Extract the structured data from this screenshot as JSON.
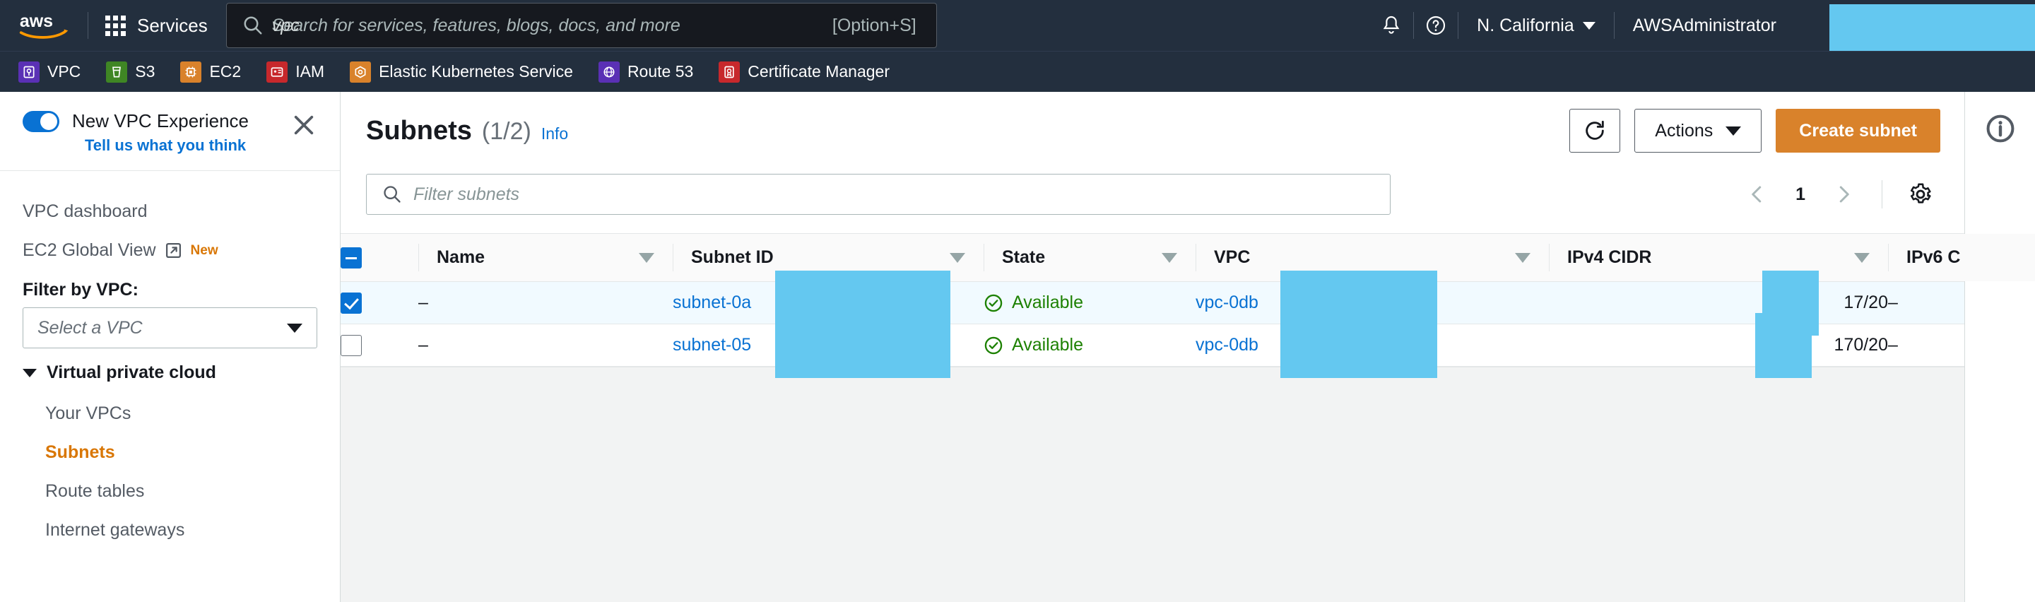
{
  "topnav": {
    "logo_alt": "aws",
    "services_label": "Services",
    "search": {
      "placeholder": "Search for services, features, blogs, docs, and more",
      "value": "vpc",
      "shortcut": "[Option+S]"
    },
    "bell_icon": "notifications-bell-icon",
    "help_icon": "help-circle-icon",
    "region": "N. California",
    "account": "AWSAdministrator",
    "redacted": true
  },
  "service_bar": {
    "items": [
      {
        "label": "VPC",
        "color": "#5a30b5",
        "icon": "vpc-icon"
      },
      {
        "label": "S3",
        "color": "#3f8624",
        "icon": "s3-bucket-icon"
      },
      {
        "label": "EC2",
        "color": "#d9822b",
        "icon": "ec2-instance-icon"
      },
      {
        "label": "IAM",
        "color": "#c7282c",
        "icon": "iam-icon"
      },
      {
        "label": "Elastic Kubernetes Service",
        "color": "#d9822b",
        "icon": "eks-icon"
      },
      {
        "label": "Route 53",
        "color": "#5a30b5",
        "icon": "route53-icon"
      },
      {
        "label": "Certificate Manager",
        "color": "#c7282c",
        "icon": "certificate-icon"
      }
    ]
  },
  "sidebar": {
    "new_experience": {
      "title": "New VPC Experience",
      "feedback_link": "Tell us what you think",
      "toggle_on": true,
      "close_icon": "close-icon"
    },
    "links": [
      {
        "label": "VPC dashboard"
      },
      {
        "label": "EC2 Global View",
        "external": true,
        "badge": "New"
      }
    ],
    "filter_label": "Filter by VPC:",
    "vpc_select_placeholder": "Select a VPC",
    "group": {
      "label": "Virtual private cloud",
      "expanded": true,
      "items": [
        {
          "label": "Your VPCs",
          "active": false
        },
        {
          "label": "Subnets",
          "active": true
        },
        {
          "label": "Route tables",
          "active": false
        },
        {
          "label": "Internet gateways",
          "active": false
        }
      ]
    }
  },
  "page": {
    "title": "Subnets",
    "count": "(1/2)",
    "info_label": "Info",
    "refresh_icon": "refresh-icon",
    "actions_label": "Actions",
    "create_label": "Create subnet",
    "filter_placeholder": "Filter subnets",
    "pagination": {
      "prev_icon": "chevron-left-icon",
      "page": "1",
      "next_icon": "chevron-right-icon",
      "settings_icon": "gear-icon"
    }
  },
  "table": {
    "select_all_state": "indeterminate",
    "columns": [
      {
        "key": "name",
        "label": "Name",
        "sortable": true
      },
      {
        "key": "subnet_id",
        "label": "Subnet ID",
        "sortable": true
      },
      {
        "key": "state",
        "label": "State",
        "sortable": true
      },
      {
        "key": "vpc",
        "label": "VPC",
        "sortable": true
      },
      {
        "key": "ipv4_cidr",
        "label": "IPv4 CIDR",
        "sortable": true
      },
      {
        "key": "ipv6_cidr",
        "label": "IPv6 C",
        "sortable": false
      }
    ],
    "rows": [
      {
        "selected": true,
        "name": "–",
        "subnet_id": "subnet-0a",
        "subnet_id_redacted": true,
        "state": "Available",
        "vpc": "vpc-0db",
        "vpc_redacted": true,
        "ipv4_cidr_prefix": "17",
        "ipv4_cidr_suffix": "/20",
        "ipv4_redacted": true,
        "ipv6_cidr": "–"
      },
      {
        "selected": false,
        "name": "–",
        "subnet_id": "subnet-05",
        "subnet_id_redacted": true,
        "state": "Available",
        "vpc": "vpc-0db",
        "vpc_redacted": true,
        "ipv4_cidr_prefix": "17",
        "ipv4_cidr_suffix": "0/20",
        "ipv4_redacted": true,
        "ipv6_cidr": "–"
      }
    ]
  },
  "right_rail": {
    "info_icon": "info-circle-icon"
  },
  "colors": {
    "nav_bg": "#232f3e",
    "accent_orange": "#d9822b",
    "link_blue": "#0972d3",
    "available_green": "#1d8102",
    "redaction_blue": "#64c8f0",
    "selected_row": "#f1faff"
  }
}
